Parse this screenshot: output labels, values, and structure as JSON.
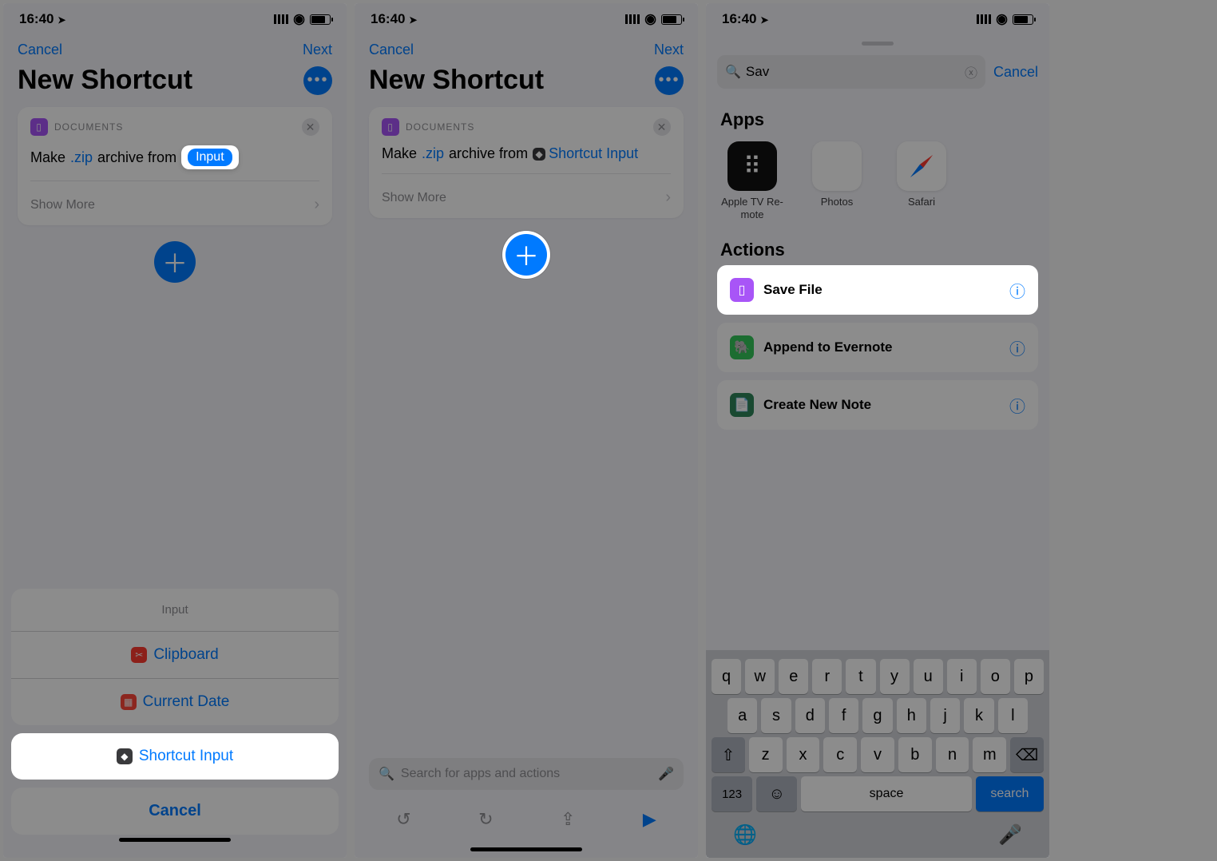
{
  "status": {
    "time": "16:40",
    "locationGlyph": "➤"
  },
  "nav": {
    "cancel": "Cancel",
    "next": "Next"
  },
  "title": "New Shortcut",
  "moreGlyph": "•••",
  "card": {
    "category": "DOCUMENTS",
    "text_make": "Make",
    "zip": ".zip",
    "archive_from": "archive from",
    "inputPill": "Input",
    "shortcutInput": "Shortcut Input",
    "showMore": "Show More"
  },
  "sheet": {
    "header": "Input",
    "clipboard": "Clipboard",
    "currentDate": "Current Date",
    "shortcutInput": "Shortcut Input",
    "cancel": "Cancel"
  },
  "search2": {
    "placeholder": "Search for apps and actions"
  },
  "bottomIcons": {
    "undo": "↺",
    "redo": "↻",
    "share": "⇪",
    "play": "▶"
  },
  "s3": {
    "searchValue": "Sav",
    "cancel": "Cancel",
    "appsHeader": "Apps",
    "actionsHeader": "Actions",
    "apps": [
      {
        "name": "Apple TV Re-\nmote"
      },
      {
        "name": "Photos"
      },
      {
        "name": "Safari"
      }
    ],
    "actions": [
      {
        "label": "Save File",
        "iconClass": "purple"
      },
      {
        "label": "Append to Evernote",
        "iconClass": "green"
      },
      {
        "label": "Create New Note",
        "iconClass": "green2"
      }
    ]
  },
  "kb": {
    "row1": [
      "q",
      "w",
      "e",
      "r",
      "t",
      "y",
      "u",
      "i",
      "o",
      "p"
    ],
    "row2": [
      "a",
      "s",
      "d",
      "f",
      "g",
      "h",
      "j",
      "k",
      "l"
    ],
    "row3": [
      "z",
      "x",
      "c",
      "v",
      "b",
      "n",
      "m"
    ],
    "shift": "⇧",
    "bksp": "⌫",
    "num": "123",
    "emoji": "☺",
    "space": "space",
    "search": "search",
    "globe": "🌐",
    "mic": "🎤"
  }
}
